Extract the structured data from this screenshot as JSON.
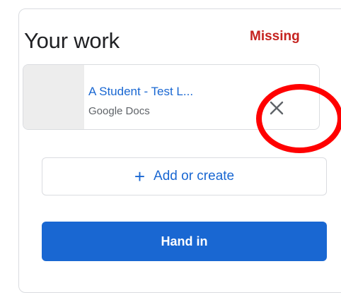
{
  "card": {
    "title": "Your work",
    "status": "Missing",
    "attachment": {
      "name": "A Student - Test L...",
      "type": "Google Docs",
      "remove_icon": "close-icon"
    },
    "add_label": "Add or create",
    "add_icon": "+",
    "submit_label": "Hand in"
  },
  "colors": {
    "accent": "#1967d2",
    "status": "#c5221f",
    "highlight": "#ff0000"
  }
}
